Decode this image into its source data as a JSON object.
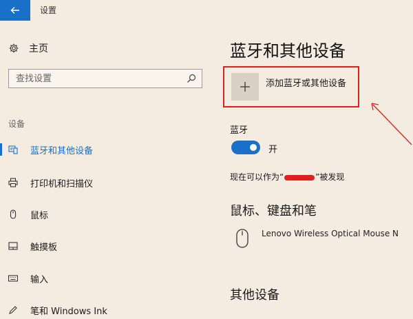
{
  "window": {
    "title": "设置"
  },
  "sidebar": {
    "home_label": "主页",
    "search_placeholder": "查找设置",
    "section_label": "设备",
    "items": [
      {
        "label": "蓝牙和其他设备",
        "icon": "bluetooth-devices-icon",
        "active": true
      },
      {
        "label": "打印机和扫描仪",
        "icon": "printer-icon",
        "active": false
      },
      {
        "label": "鼠标",
        "icon": "mouse-icon",
        "active": false
      },
      {
        "label": "触摸板",
        "icon": "touchpad-icon",
        "active": false
      },
      {
        "label": "输入",
        "icon": "keyboard-icon",
        "active": false
      },
      {
        "label": "笔和 Windows Ink",
        "icon": "pen-icon",
        "active": false
      }
    ]
  },
  "main": {
    "title": "蓝牙和其他设备",
    "add_device_label": "添加蓝牙或其他设备",
    "bluetooth_label": "蓝牙",
    "bluetooth_state": "开",
    "discover_prefix": "现在可以作为“",
    "discover_suffix": "”被发现",
    "mouse_section_title": "鼠标、键盘和笔",
    "mouse_device_name": "Lenovo Wireless Optical Mouse N",
    "other_section_title": "其他设备"
  },
  "colors": {
    "accent": "#1a70c8",
    "highlight": "#e02020",
    "background": "#f5ece1"
  }
}
